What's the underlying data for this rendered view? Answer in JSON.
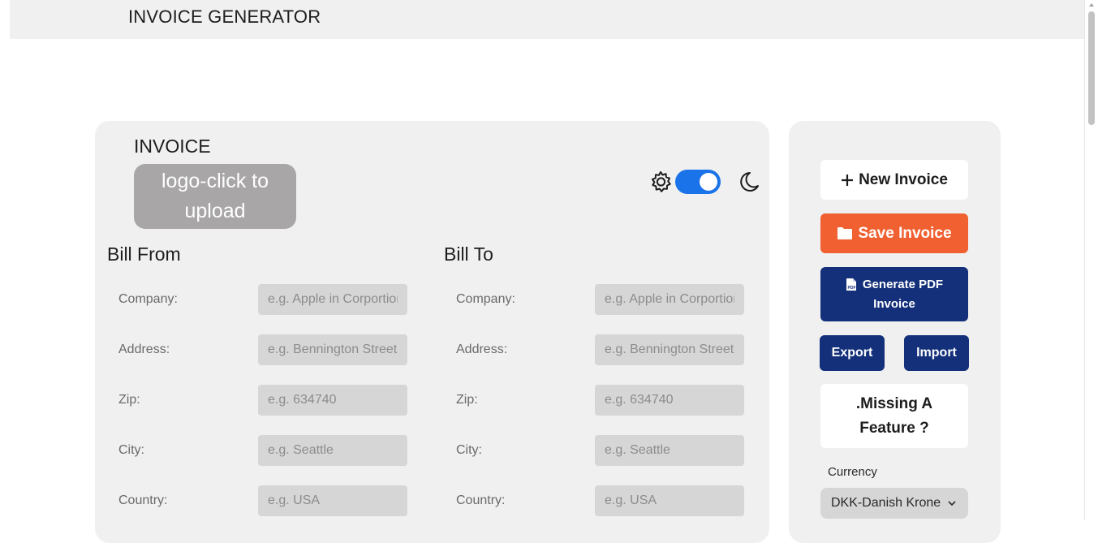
{
  "header": {
    "title": "INVOICE GENERATOR"
  },
  "invoice": {
    "heading": "INVOICE",
    "logo_upload_label": "logo-click to upload",
    "theme": {
      "toggle_on": true,
      "light_icon": "sun-icon",
      "dark_icon": "moon-icon"
    },
    "bill_from": {
      "title": "Bill From",
      "fields": [
        {
          "label": "Company:",
          "placeholder": "e.g. Apple in Corportion",
          "value": ""
        },
        {
          "label": "Address:",
          "placeholder": "e.g. Bennington Street",
          "value": ""
        },
        {
          "label": "Zip:",
          "placeholder": "e.g. 634740",
          "value": ""
        },
        {
          "label": "City:",
          "placeholder": "e.g. Seattle",
          "value": ""
        },
        {
          "label": "Country:",
          "placeholder": "e.g. USA",
          "value": ""
        }
      ]
    },
    "bill_to": {
      "title": "Bill To",
      "fields": [
        {
          "label": "Company:",
          "placeholder": "e.g. Apple in Corportion",
          "value": ""
        },
        {
          "label": "Address:",
          "placeholder": "e.g. Bennington Street",
          "value": ""
        },
        {
          "label": "Zip:",
          "placeholder": "e.g. 634740",
          "value": ""
        },
        {
          "label": "City:",
          "placeholder": "e.g. Seattle",
          "value": ""
        },
        {
          "label": "Country:",
          "placeholder": "e.g. USA",
          "value": ""
        }
      ]
    }
  },
  "sidebar": {
    "new_invoice": "New Invoice",
    "save_invoice": "Save Invoice",
    "generate_pdf_line1": "Generate PDF",
    "generate_pdf_line2": "Invoice",
    "export": "Export",
    "import": "Import",
    "missing_feature_line1": ".Missing A",
    "missing_feature_line2": "Feature ?",
    "currency_label": "Currency",
    "currency_selected": "DKK-Danish Krone"
  },
  "colors": {
    "accent_orange": "#f06030",
    "accent_navy": "#14307a",
    "toggle_blue": "#1a73e8",
    "panel_bg": "#f0f0f0"
  }
}
